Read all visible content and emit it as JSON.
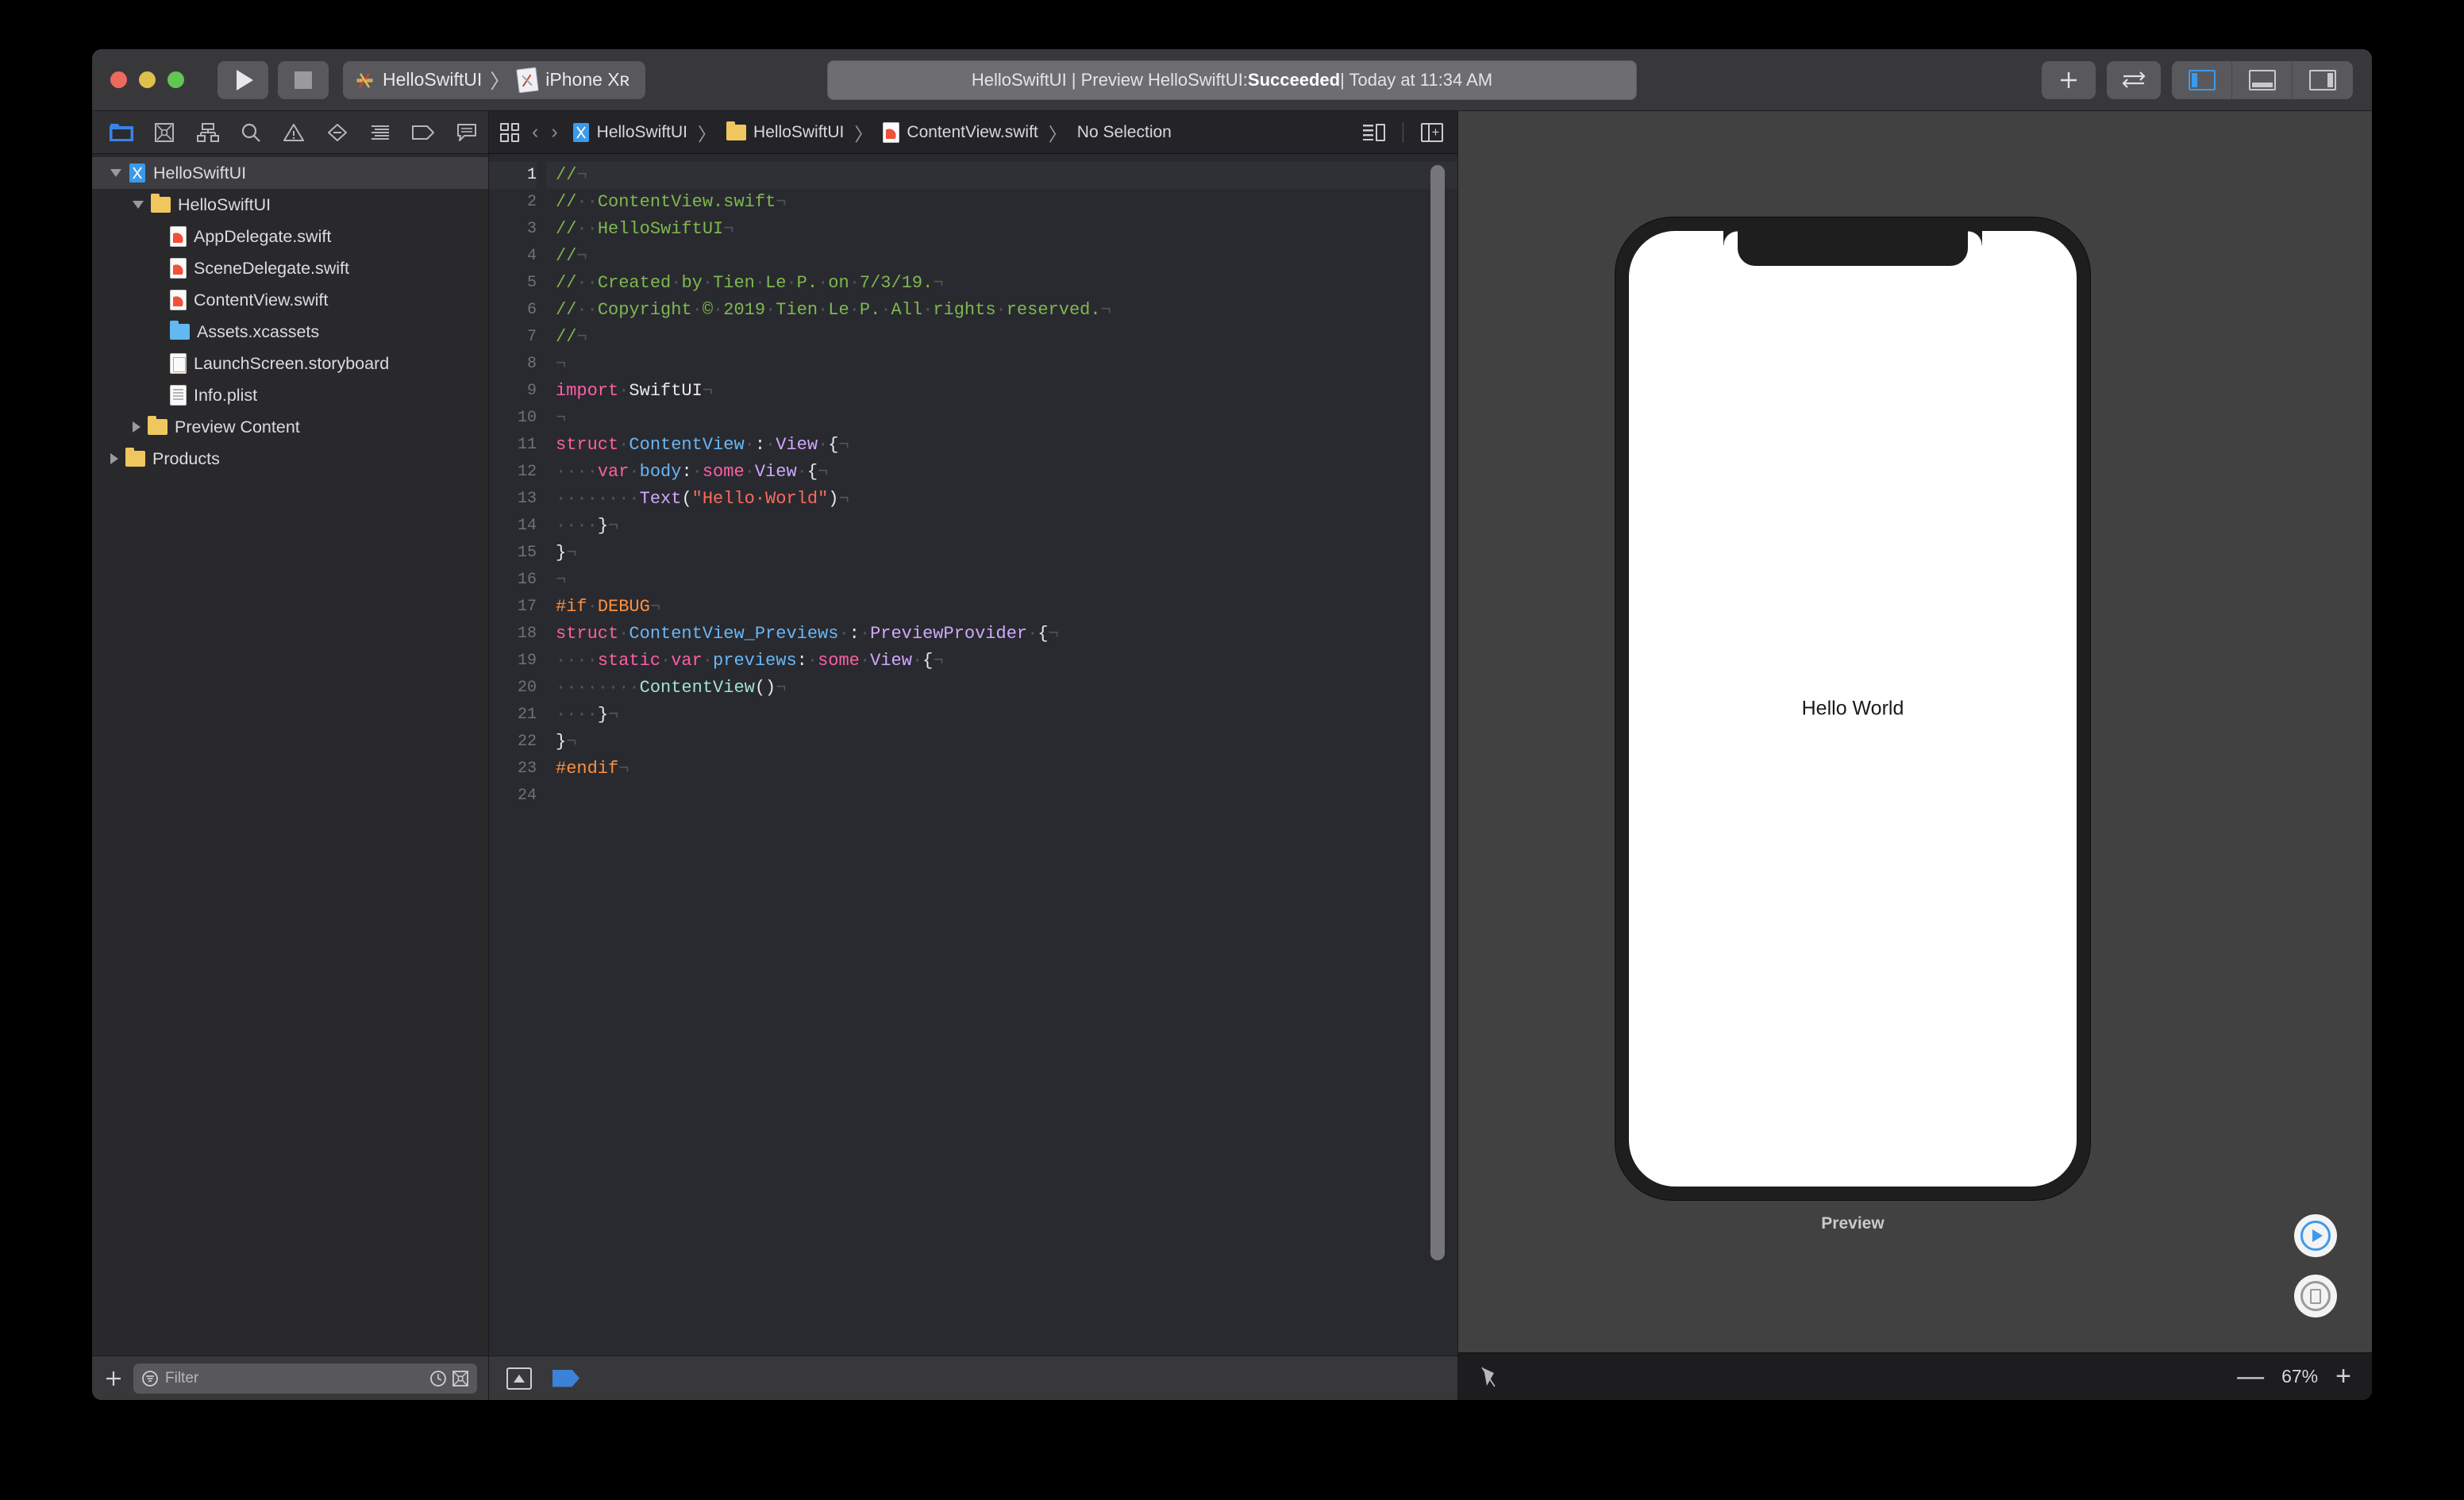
{
  "window": {
    "traffic_lights": [
      "close",
      "minimize",
      "zoom"
    ]
  },
  "toolbar": {
    "run_label": "Run",
    "stop_label": "Stop",
    "scheme_project": "HelloSwiftUI",
    "scheme_separator": "〉",
    "scheme_destination": "iPhone Xʀ",
    "status": {
      "prefix": "HelloSwiftUI | Preview HelloSwiftUI: ",
      "result": "Succeeded",
      "suffix": " | Today at 11:34 AM",
      "full": "HelloSwiftUI | Preview HelloSwiftUI: Succeeded | Today at 11:34 AM"
    },
    "add_label": "+",
    "swap_label": "⇄",
    "layout_buttons": [
      "navigator",
      "debug-area",
      "inspector"
    ]
  },
  "navigator": {
    "tabs": [
      "project-navigator-icon",
      "source-control-navigator-icon",
      "symbol-navigator-icon",
      "find-navigator-icon",
      "issue-navigator-icon",
      "test-navigator-icon",
      "debug-navigator-icon",
      "breakpoint-navigator-icon",
      "report-navigator-icon"
    ],
    "selected_tab": "project-navigator-icon",
    "tree": [
      {
        "label": "HelloSwiftUI",
        "icon": "xcode-project-icon",
        "depth": 0,
        "disclosure": "open",
        "selected": true
      },
      {
        "label": "HelloSwiftUI",
        "icon": "folder-yellow-icon",
        "depth": 1,
        "disclosure": "open",
        "selected": false
      },
      {
        "label": "AppDelegate.swift",
        "icon": "swift-file-icon",
        "depth": 2,
        "disclosure": "none",
        "selected": false
      },
      {
        "label": "SceneDelegate.swift",
        "icon": "swift-file-icon",
        "depth": 2,
        "disclosure": "none",
        "selected": false
      },
      {
        "label": "ContentView.swift",
        "icon": "swift-file-icon",
        "depth": 2,
        "disclosure": "none",
        "selected": false
      },
      {
        "label": "Assets.xcassets",
        "icon": "assets-folder-icon",
        "depth": 2,
        "disclosure": "none",
        "selected": false
      },
      {
        "label": "LaunchScreen.storyboard",
        "icon": "storyboard-file-icon",
        "depth": 2,
        "disclosure": "none",
        "selected": false
      },
      {
        "label": "Info.plist",
        "icon": "plist-file-icon",
        "depth": 2,
        "disclosure": "none",
        "selected": false
      },
      {
        "label": "Preview Content",
        "icon": "folder-yellow-icon",
        "depth": 1,
        "disclosure": "closed",
        "selected": false
      },
      {
        "label": "Products",
        "icon": "folder-yellow-icon",
        "depth": 0,
        "disclosure": "closed",
        "selected": false
      }
    ],
    "bottom": {
      "add_label": "+",
      "filter_placeholder": "Filter",
      "filter_value": "",
      "recent_icon": "clock-icon",
      "source-control_icon": "source-control-filter-icon"
    }
  },
  "editor": {
    "jumpbar": {
      "grid_icon": "related-items-icon",
      "back_label": "‹",
      "forward_label": "›",
      "crumbs": [
        {
          "label": "HelloSwiftUI",
          "icon": "xcode-project-icon"
        },
        {
          "label": "HelloSwiftUI",
          "icon": "folder-yellow-icon"
        },
        {
          "label": "ContentView.swift",
          "icon": "swift-file-icon"
        },
        {
          "label": "No Selection",
          "icon": "none"
        }
      ],
      "separator": "〉",
      "right_icons": [
        "assistant-editor-icon",
        "add-editor-icon"
      ]
    },
    "filename": "ContentView.swift",
    "cursor_line": 1,
    "total_lines": 24,
    "lines": [
      {
        "n": 1,
        "tokens": [
          {
            "t": "//",
            "c": "cm"
          },
          {
            "t": "¬",
            "c": "inv"
          }
        ]
      },
      {
        "n": 2,
        "tokens": [
          {
            "t": "//",
            "c": "cm"
          },
          {
            "t": "··",
            "c": "inv"
          },
          {
            "t": "ContentView.swift",
            "c": "cm"
          },
          {
            "t": "¬",
            "c": "inv"
          }
        ]
      },
      {
        "n": 3,
        "tokens": [
          {
            "t": "//",
            "c": "cm"
          },
          {
            "t": "··",
            "c": "inv"
          },
          {
            "t": "HelloSwiftUI",
            "c": "cm"
          },
          {
            "t": "¬",
            "c": "inv"
          }
        ]
      },
      {
        "n": 4,
        "tokens": [
          {
            "t": "//",
            "c": "cm"
          },
          {
            "t": "¬",
            "c": "inv"
          }
        ]
      },
      {
        "n": 5,
        "tokens": [
          {
            "t": "//",
            "c": "cm"
          },
          {
            "t": "··",
            "c": "inv"
          },
          {
            "t": "Created",
            "c": "cm"
          },
          {
            "t": "·",
            "c": "inv"
          },
          {
            "t": "by",
            "c": "cm"
          },
          {
            "t": "·",
            "c": "inv"
          },
          {
            "t": "Tien",
            "c": "cm"
          },
          {
            "t": "·",
            "c": "inv"
          },
          {
            "t": "Le",
            "c": "cm"
          },
          {
            "t": "·",
            "c": "inv"
          },
          {
            "t": "P.",
            "c": "cm"
          },
          {
            "t": "·",
            "c": "inv"
          },
          {
            "t": "on",
            "c": "cm"
          },
          {
            "t": "·",
            "c": "inv"
          },
          {
            "t": "7/3/19.",
            "c": "cm"
          },
          {
            "t": "¬",
            "c": "inv"
          }
        ]
      },
      {
        "n": 6,
        "tokens": [
          {
            "t": "//",
            "c": "cm"
          },
          {
            "t": "··",
            "c": "inv"
          },
          {
            "t": "Copyright",
            "c": "cm"
          },
          {
            "t": "·",
            "c": "inv"
          },
          {
            "t": "©",
            "c": "cm"
          },
          {
            "t": "·",
            "c": "inv"
          },
          {
            "t": "2019",
            "c": "cm"
          },
          {
            "t": "·",
            "c": "inv"
          },
          {
            "t": "Tien",
            "c": "cm"
          },
          {
            "t": "·",
            "c": "inv"
          },
          {
            "t": "Le",
            "c": "cm"
          },
          {
            "t": "·",
            "c": "inv"
          },
          {
            "t": "P.",
            "c": "cm"
          },
          {
            "t": "·",
            "c": "inv"
          },
          {
            "t": "All",
            "c": "cm"
          },
          {
            "t": "·",
            "c": "inv"
          },
          {
            "t": "rights",
            "c": "cm"
          },
          {
            "t": "·",
            "c": "inv"
          },
          {
            "t": "reserved.",
            "c": "cm"
          },
          {
            "t": "¬",
            "c": "inv"
          }
        ]
      },
      {
        "n": 7,
        "tokens": [
          {
            "t": "//",
            "c": "cm"
          },
          {
            "t": "¬",
            "c": "inv"
          }
        ]
      },
      {
        "n": 8,
        "tokens": [
          {
            "t": "¬",
            "c": "inv"
          }
        ]
      },
      {
        "n": 9,
        "tokens": [
          {
            "t": "import",
            "c": "kw"
          },
          {
            "t": "·",
            "c": "inv"
          },
          {
            "t": "SwiftUI",
            "c": "pl"
          },
          {
            "t": "¬",
            "c": "inv"
          }
        ]
      },
      {
        "n": 10,
        "tokens": [
          {
            "t": "¬",
            "c": "inv"
          }
        ]
      },
      {
        "n": 11,
        "tokens": [
          {
            "t": "struct",
            "c": "kw"
          },
          {
            "t": "·",
            "c": "inv"
          },
          {
            "t": "ContentView",
            "c": "tyb"
          },
          {
            "t": "·",
            "c": "inv"
          },
          {
            "t": ":",
            "c": "pl"
          },
          {
            "t": "·",
            "c": "inv"
          },
          {
            "t": "View",
            "c": "ty"
          },
          {
            "t": "·",
            "c": "inv"
          },
          {
            "t": "{",
            "c": "pl"
          },
          {
            "t": "¬",
            "c": "inv"
          }
        ]
      },
      {
        "n": 12,
        "tokens": [
          {
            "t": "····",
            "c": "inv"
          },
          {
            "t": "var",
            "c": "kw"
          },
          {
            "t": "·",
            "c": "inv"
          },
          {
            "t": "body",
            "c": "tyb"
          },
          {
            "t": ":",
            "c": "pl"
          },
          {
            "t": "·",
            "c": "inv"
          },
          {
            "t": "some",
            "c": "kw"
          },
          {
            "t": "·",
            "c": "inv"
          },
          {
            "t": "View",
            "c": "ty"
          },
          {
            "t": "·",
            "c": "inv"
          },
          {
            "t": "{",
            "c": "pl"
          },
          {
            "t": "¬",
            "c": "inv"
          }
        ]
      },
      {
        "n": 13,
        "tokens": [
          {
            "t": "········",
            "c": "inv"
          },
          {
            "t": "Text",
            "c": "ty"
          },
          {
            "t": "(",
            "c": "pl"
          },
          {
            "t": "\"Hello·World\"",
            "c": "st"
          },
          {
            "t": ")",
            "c": "pl"
          },
          {
            "t": "¬",
            "c": "inv"
          }
        ]
      },
      {
        "n": 14,
        "tokens": [
          {
            "t": "····",
            "c": "inv"
          },
          {
            "t": "}",
            "c": "pl"
          },
          {
            "t": "¬",
            "c": "inv"
          }
        ]
      },
      {
        "n": 15,
        "tokens": [
          {
            "t": "}",
            "c": "pl"
          },
          {
            "t": "¬",
            "c": "inv"
          }
        ]
      },
      {
        "n": 16,
        "tokens": [
          {
            "t": "¬",
            "c": "inv"
          }
        ]
      },
      {
        "n": 17,
        "tokens": [
          {
            "t": "#if",
            "c": "pp"
          },
          {
            "t": "·",
            "c": "inv"
          },
          {
            "t": "DEBUG",
            "c": "pp"
          },
          {
            "t": "¬",
            "c": "inv"
          }
        ]
      },
      {
        "n": 18,
        "tokens": [
          {
            "t": "struct",
            "c": "kw"
          },
          {
            "t": "·",
            "c": "inv"
          },
          {
            "t": "ContentView_Previews",
            "c": "tyb"
          },
          {
            "t": "·",
            "c": "inv"
          },
          {
            "t": ":",
            "c": "pl"
          },
          {
            "t": "·",
            "c": "inv"
          },
          {
            "t": "PreviewProvider",
            "c": "ty"
          },
          {
            "t": "·",
            "c": "inv"
          },
          {
            "t": "{",
            "c": "pl"
          },
          {
            "t": "¬",
            "c": "inv"
          }
        ]
      },
      {
        "n": 19,
        "tokens": [
          {
            "t": "····",
            "c": "inv"
          },
          {
            "t": "static",
            "c": "kw"
          },
          {
            "t": "·",
            "c": "inv"
          },
          {
            "t": "var",
            "c": "kw"
          },
          {
            "t": "·",
            "c": "inv"
          },
          {
            "t": "previews",
            "c": "tyb"
          },
          {
            "t": ":",
            "c": "pl"
          },
          {
            "t": "·",
            "c": "inv"
          },
          {
            "t": "some",
            "c": "kw"
          },
          {
            "t": "·",
            "c": "inv"
          },
          {
            "t": "View",
            "c": "ty"
          },
          {
            "t": "·",
            "c": "inv"
          },
          {
            "t": "{",
            "c": "pl"
          },
          {
            "t": "¬",
            "c": "inv"
          }
        ]
      },
      {
        "n": 20,
        "tokens": [
          {
            "t": "········",
            "c": "inv"
          },
          {
            "t": "ContentView",
            "c": "fn"
          },
          {
            "t": "()",
            "c": "pl"
          },
          {
            "t": "¬",
            "c": "inv"
          }
        ]
      },
      {
        "n": 21,
        "tokens": [
          {
            "t": "····",
            "c": "inv"
          },
          {
            "t": "}",
            "c": "pl"
          },
          {
            "t": "¬",
            "c": "inv"
          }
        ]
      },
      {
        "n": 22,
        "tokens": [
          {
            "t": "}",
            "c": "pl"
          },
          {
            "t": "¬",
            "c": "inv"
          }
        ]
      },
      {
        "n": 23,
        "tokens": [
          {
            "t": "#endif",
            "c": "pp"
          },
          {
            "t": "¬",
            "c": "inv"
          }
        ]
      },
      {
        "n": 24,
        "tokens": []
      }
    ],
    "bottom_icons": [
      "show-debug-area-icon",
      "breakpoint-toggle-icon"
    ]
  },
  "canvas": {
    "device": "iPhone Xʀ",
    "preview_text": "Hello World",
    "preview_label": "Preview",
    "controls": [
      "live-preview-play-icon",
      "run-on-device-icon"
    ],
    "bottom": {
      "pin_icon": "pin-icon",
      "zoom_out": "—",
      "zoom_level": "67%",
      "zoom_in": "+"
    }
  },
  "colors": {
    "accent_blue": "#3b9aeb",
    "comment_green": "#7eb84f",
    "keyword_pink": "#fc5fa3",
    "type_purple": "#d0a8ff",
    "decl_blue": "#67b7f7",
    "string_red": "#fc6a5d",
    "preproc_orange": "#fd8f3f",
    "canvas_bg": "#414141",
    "editor_bg": "#292a2f",
    "navigator_bg": "#29292c"
  }
}
